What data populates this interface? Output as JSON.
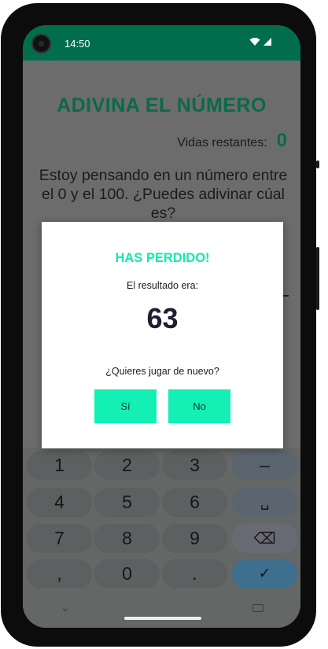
{
  "status_bar": {
    "time": "14:50"
  },
  "app": {
    "title": "ADIVINA EL NÚMERO",
    "lives_label": "Vidas restantes:",
    "lives_value": "0",
    "question": "Estoy pensando en un número entre el 0 y el 100. ¿Puedes adivinar cúal es?"
  },
  "dialog": {
    "title": "HAS PERDIDO!",
    "subtitle": "El resultado era:",
    "result": "63",
    "question": "¿Quieres jugar de nuevo?",
    "yes_label": "Sí",
    "no_label": "No"
  },
  "keyboard": {
    "keys": [
      "1",
      "2",
      "3",
      "–",
      "4",
      "5",
      "6",
      "␣",
      "7",
      "8",
      "9",
      "⌫",
      ",",
      "0",
      ".",
      "✓"
    ]
  },
  "colors": {
    "status_bar": "#006e4d",
    "title_green": "#0a6a48",
    "dialog_accent": "#14e8b0",
    "dialog_button": "#14f0b4"
  }
}
